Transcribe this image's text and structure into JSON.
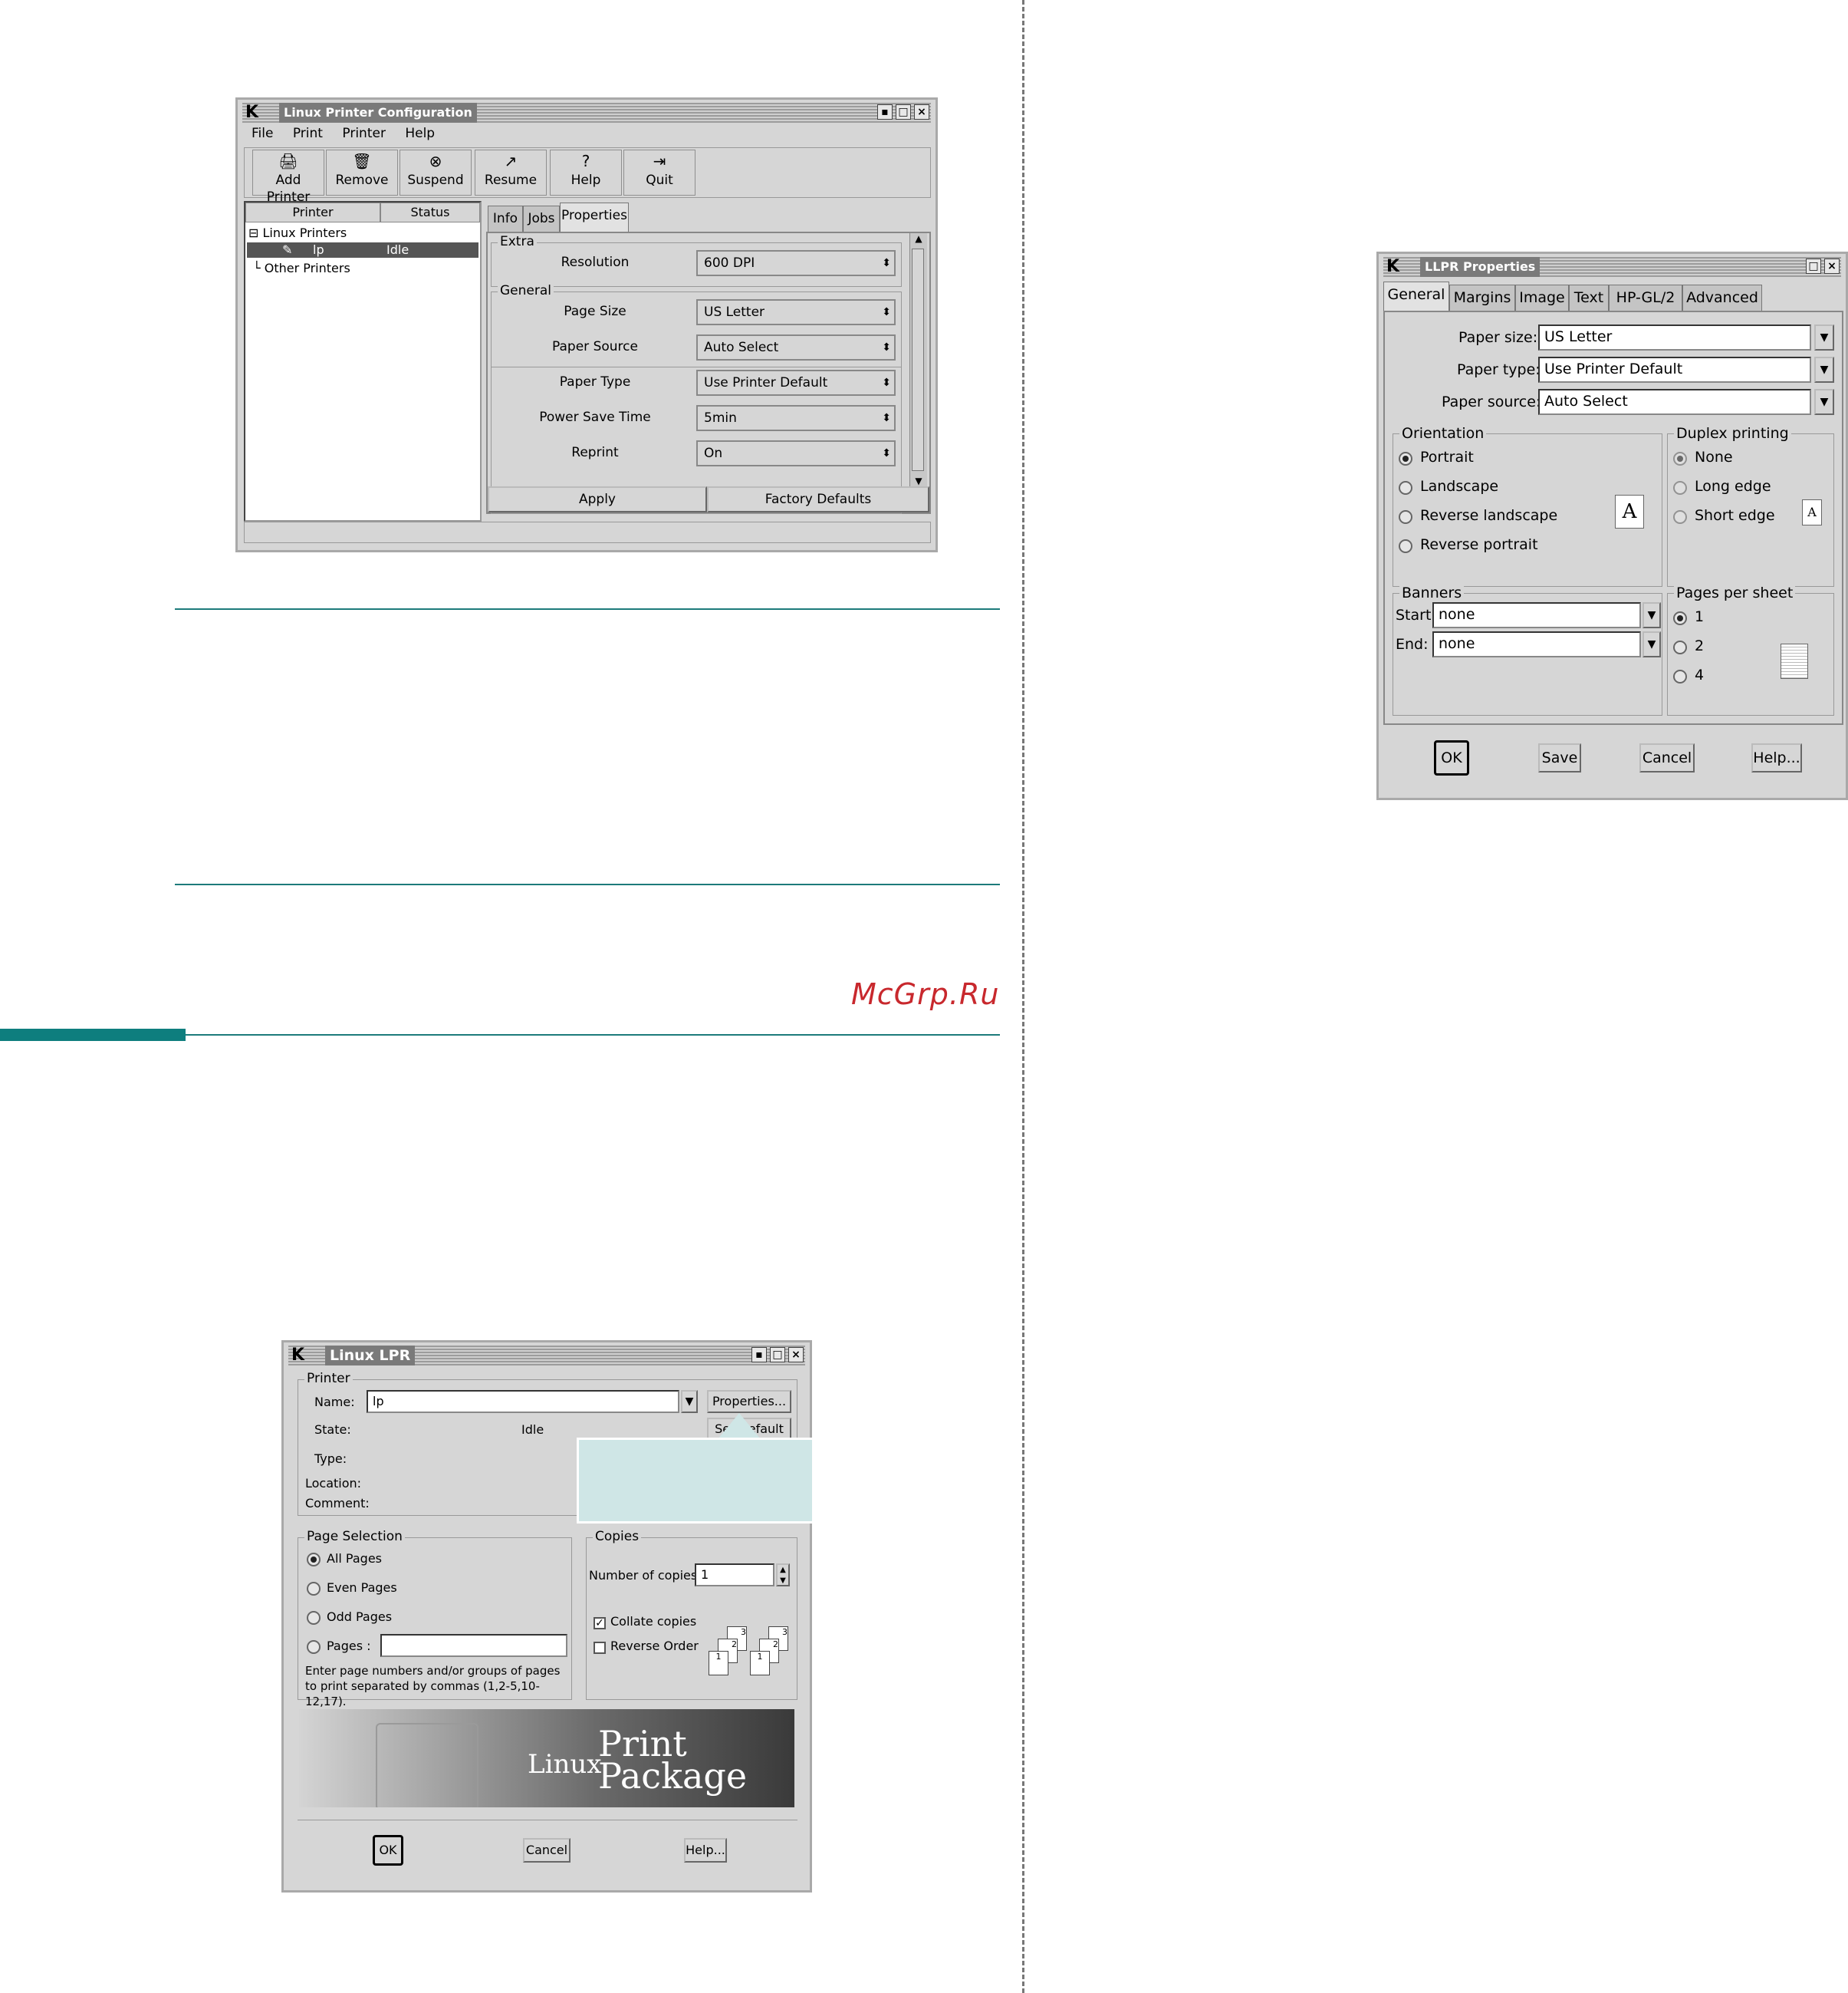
{
  "watermark": "McGrp.Ru",
  "lpc": {
    "title": "Linux Printer Configuration",
    "menu": [
      "File",
      "Print",
      "Printer",
      "Help"
    ],
    "toolbar": [
      "Add Printer",
      "Remove",
      "Suspend",
      "Resume",
      "Help",
      "Quit"
    ],
    "list_headers": [
      "Printer",
      "Status"
    ],
    "tree": {
      "linux": "Linux Printers",
      "printer_name": "lp",
      "printer_status": "Idle",
      "other": "Other Printers"
    },
    "tabs": [
      "Info",
      "Jobs",
      "Properties"
    ],
    "extra_label": "Extra",
    "general_label": "General",
    "rows": [
      {
        "label": "Resolution",
        "value": "600 DPI"
      },
      {
        "label": "Page Size",
        "value": "US Letter"
      },
      {
        "label": "Paper Source",
        "value": "Auto Select"
      },
      {
        "label": "Paper Type",
        "value": "Use Printer Default"
      },
      {
        "label": "Power Save Time",
        "value": "5min"
      },
      {
        "label": "Reprint",
        "value": "On"
      }
    ],
    "apply": "Apply",
    "factory": "Factory Defaults"
  },
  "llpr": {
    "title": "LLPR Properties",
    "tabs": [
      "General",
      "Margins",
      "Image",
      "Text",
      "HP-GL/2",
      "Advanced"
    ],
    "paper_size_label": "Paper size:",
    "paper_size": "US Letter",
    "paper_type_label": "Paper type:",
    "paper_type": "Use Printer Default",
    "paper_source_label": "Paper source:",
    "paper_source": "Auto Select",
    "orientation_label": "Orientation",
    "orientations": [
      "Portrait",
      "Landscape",
      "Reverse landscape",
      "Reverse portrait"
    ],
    "duplex_label": "Duplex printing",
    "duplex": [
      "None",
      "Long edge",
      "Short edge"
    ],
    "banners_label": "Banners",
    "start_label": "Start:",
    "start_value": "none",
    "end_label": "End:",
    "end_value": "none",
    "pps_label": "Pages per sheet",
    "pps": [
      "1",
      "2",
      "4"
    ],
    "doc_letter": "A",
    "buttons": [
      "OK",
      "Save",
      "Cancel",
      "Help..."
    ]
  },
  "lpr": {
    "title": "Linux LPR",
    "printer_group": "Printer",
    "name_label": "Name:",
    "name_value": "lp",
    "properties_btn": "Properties...",
    "state_label": "State:",
    "state_value": "Idle",
    "set_default_btn": "Set Default",
    "type_label": "Type:",
    "location_label": "Location:",
    "comment_label": "Comment:",
    "page_selection_label": "Page Selection",
    "page_options": [
      "All Pages",
      "Even Pages",
      "Odd Pages",
      "Pages :"
    ],
    "pages_hint": "Enter page numbers and/or groups of pages to print separated by commas (1,2-5,10-12,17).",
    "copies_label": "Copies",
    "num_copies_label": "Number of copies:",
    "num_copies": "1",
    "collate": "Collate copies",
    "reverse": "Reverse Order",
    "banner_linux": "Linux",
    "banner_print": "Print",
    "banner_package": "Package",
    "buttons": [
      "OK",
      "Cancel",
      "Help..."
    ]
  }
}
